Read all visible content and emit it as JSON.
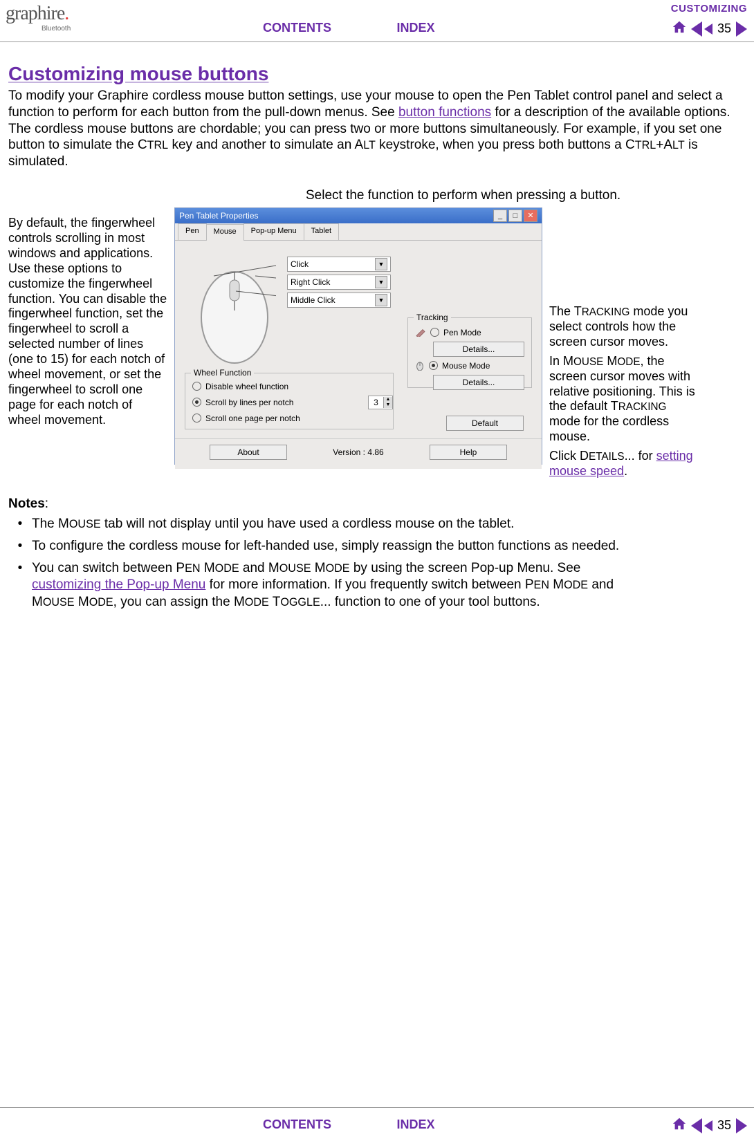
{
  "header": {
    "logo_text": "graphire",
    "bluetooth": "Bluetooth",
    "section": "CUSTOMIZING",
    "contents": "CONTENTS",
    "index": "INDEX",
    "page_number": "35"
  },
  "title": "Customizing mouse buttons",
  "intro_parts": {
    "p1": "To modify your Graphire cordless mouse button settings, use your mouse to open the Pen Tablet control panel and select a function to perform for each button from the pull-down menus.  See ",
    "link1": "button functions",
    "p2": " for a description of the available options.  The cordless mouse buttons are chordable; you can press two or more buttons simultaneously.  For example, if you set one button to simulate the C",
    "ctrl_sc": "TRL",
    "p3": " key and another to simulate an A",
    "alt_sc": "LT",
    "p4": " keystroke, when you press both buttons a C",
    "ctrl2_sc": "TRL",
    "p5": "+A",
    "alt2_sc": "LT",
    "p6": " is simulated."
  },
  "callout_top": "Select the function to perform when pressing a button.",
  "left_callout": "By default, the fingerwheel controls scrolling in most windows and applications. Use these options to customize the fingerwheel function.  You can disable the fingerwheel function, set the fingerwheel to scroll a selected number of lines (one to 15) for each notch of wheel movement, or set the fingerwheel to scroll one page for each notch of wheel movement.",
  "right_callout": {
    "p1a": "The T",
    "p1a_sc": "RACKING",
    "p1b": " mode you select controls how the screen cursor moves.",
    "p2a": "In M",
    "p2a_sc": "OUSE",
    "p2b": " M",
    "p2b_sc": "ODE",
    "p2c": ", the screen cursor moves with relative positioning.  This is the default T",
    "p2c_sc": "RACKING",
    "p2d": " mode for the cordless mouse.",
    "p3a": "Click D",
    "p3a_sc": "ETAILS",
    "p3b": "... for ",
    "link": "setting mouse speed",
    "p3c": "."
  },
  "window": {
    "title": "Pen Tablet Properties",
    "tabs": [
      "Pen",
      "Mouse",
      "Pop-up Menu",
      "Tablet"
    ],
    "active_tab": "Mouse",
    "buttons": {
      "click": "Click",
      "rclick": "Right Click",
      "mclick": "Middle Click"
    },
    "wheel_section": {
      "legend": "Wheel Function",
      "disable": "Disable wheel function",
      "scroll_lines": "Scroll by lines per notch",
      "scroll_page": "Scroll one page per notch",
      "lines_value": "3"
    },
    "tracking": {
      "legend": "Tracking",
      "pen_mode": "Pen Mode",
      "mouse_mode": "Mouse Mode",
      "details": "Details..."
    },
    "default_btn": "Default",
    "about": "About",
    "version": "Version : 4.86",
    "help": "Help"
  },
  "notes": {
    "header": "Notes",
    "items": [
      {
        "pre": "The M",
        "sc1": "OUSE",
        "post": " tab will not display until you have used a cordless mouse on the tablet."
      },
      {
        "pre": "To configure the cordless mouse for left-handed use, simply reassign the button functions as needed.",
        "sc1": "",
        "post": ""
      },
      {
        "pre": "You can switch between P",
        "sc1": "EN",
        "m1": " M",
        "sc2": "ODE",
        "m2": " and M",
        "sc3": "OUSE",
        "m3": " M",
        "sc4": "ODE",
        "m4": " by using the screen Pop-up Menu.  See ",
        "link": "customizing the Pop-up Menu",
        "m5": " for more information.  If you frequently switch between P",
        "sc5": "EN",
        "m6": " M",
        "sc6": "ODE",
        "m7": " and M",
        "sc7": "OUSE",
        "m8": " M",
        "sc8": "ODE",
        "m9": ", you can assign the M",
        "sc9": "ODE",
        "m10": " T",
        "sc10": "OGGLE",
        "post": "... function to one of your tool buttons."
      }
    ]
  }
}
